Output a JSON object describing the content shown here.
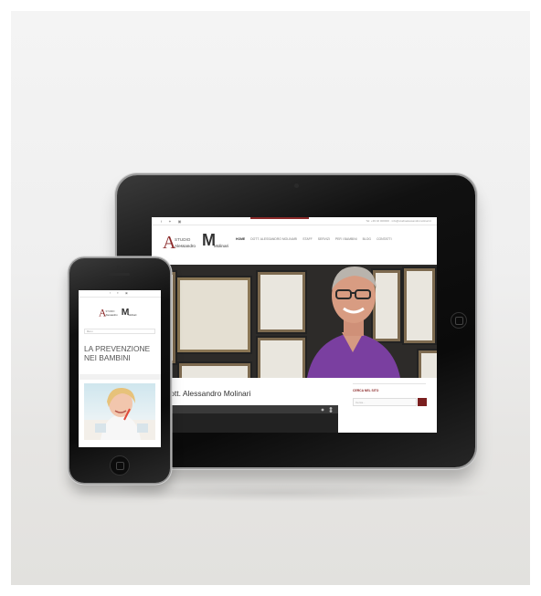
{
  "tablet": {
    "topbar": {
      "social": "f  ✦  ▣",
      "contact": "Tel: +39 02 000000 · info@studioalessandromolinari.it"
    },
    "logo": {
      "letter_a": "A",
      "letter_m": "M",
      "studio": "STUDIO",
      "name_first": "Alessandro",
      "name_last": "Molinari"
    },
    "nav": [
      {
        "label": "Home",
        "active": true
      },
      {
        "label": "Dott. Alessandro Molinari"
      },
      {
        "label": "Staff"
      },
      {
        "label": "Servizi"
      },
      {
        "label": "Per i bambini"
      },
      {
        "label": "Blog"
      },
      {
        "label": "Contatti"
      }
    ],
    "heading": "Dott. Alessandro Molinari",
    "sidebar": {
      "title": "Cerca nel sito",
      "search_placeholder": "Cerca..."
    }
  },
  "phone": {
    "topbar": {
      "social": "f ✦ ▣"
    },
    "logo": {
      "letter_a": "A",
      "letter_m": "M",
      "studio": "STUDIO",
      "name_first": "Alessandro",
      "name_last": "Molinari"
    },
    "menu_label": "Menu",
    "title_line1": "La prevenzione",
    "title_line2": "nei bambini"
  },
  "colors": {
    "brand_red": "#8b2a2a",
    "shirt_purple": "#7a3fa0",
    "device_black": "#0b0b0b"
  }
}
